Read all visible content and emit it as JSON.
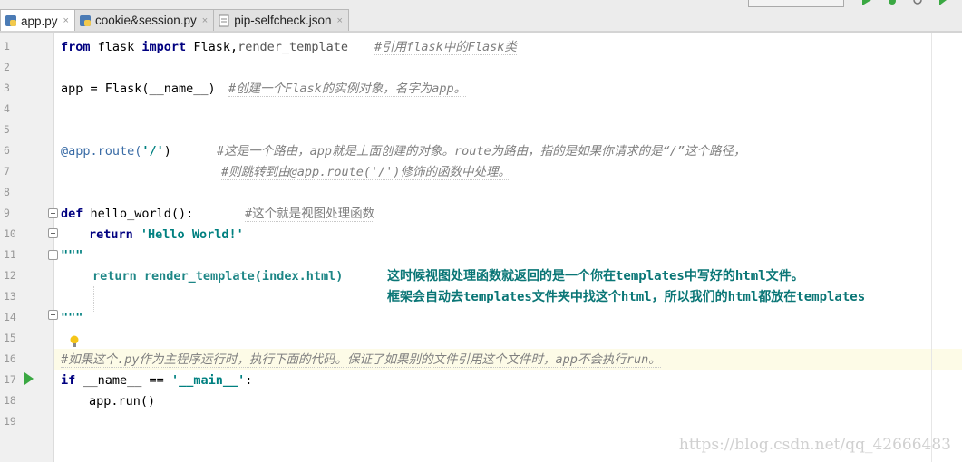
{
  "tabs": [
    {
      "label": "app.py",
      "active": true
    },
    {
      "label": "cookie&session.py",
      "active": false
    },
    {
      "label": "pip-selfcheck.json",
      "active": false
    }
  ],
  "tab_close_glyph": "×",
  "line_numbers": [
    "1",
    "2",
    "3",
    "4",
    "5",
    "6",
    "7",
    "8",
    "9",
    "10",
    "11",
    "12",
    "13",
    "14",
    "15",
    "16",
    "17",
    "18",
    "19"
  ],
  "code": {
    "l1_kw1": "from",
    "l1_mod": " flask ",
    "l1_kw2": "import",
    "l1_rest": " Flask,",
    "l1_rt": "render_template",
    "l1_cmt": "#引用flask中的Flask类",
    "l3_code": "app = Flask(__name__)",
    "l3_cmt": "#创建一个Flask的实例对象，名字为app。",
    "l6_deco": "@app.route(",
    "l6_str": "'/'",
    "l6_close": ")",
    "l6_cmt": "#这是一个路由，app就是上面创建的对象。route为路由，指的是如果你请求的是“/”这个路径，",
    "l7_cmt": "#则跳转到由@app.route('/')修饰的函数中处理。",
    "l9_kw": "def",
    "l9_fn": " hello_world():",
    "l9_cmt": "#这个就是视图处理函数",
    "l10_kw": "return",
    "l10_str": "'Hello World!'",
    "l11_doc": "\"\"\"",
    "l12_code": "return render_template(index.html)",
    "l12_ann": "这时候视图处理函数就返回的是一个你在templates中写好的html文件。",
    "l13_ann": "框架会自动去templates文件夹中找这个html，所以我们的html都放在templates",
    "l14_doc": "\"\"\"",
    "l16_cmt": "#如果这个.py作为主程序运行时，执行下面的代码。保证了如果别的文件引用这个文件时，app不会执行run。",
    "l17_kw": "if",
    "l17_mid": " __name__ == ",
    "l17_str": "'__main__'",
    "l17_end": ":",
    "l18_code": "app.run()"
  },
  "watermark": "https://blog.csdn.net/qq_42666483",
  "colors": {
    "keyword": "#000080",
    "string": "#008080",
    "comment": "#808080",
    "decorator": "#3a6ca6",
    "run_arrow": "#3aa842"
  },
  "icons": [
    "python-file-icon",
    "json-file-icon",
    "run-icon",
    "debug-icon",
    "lightbulb-icon",
    "fold-marker-icon"
  ]
}
